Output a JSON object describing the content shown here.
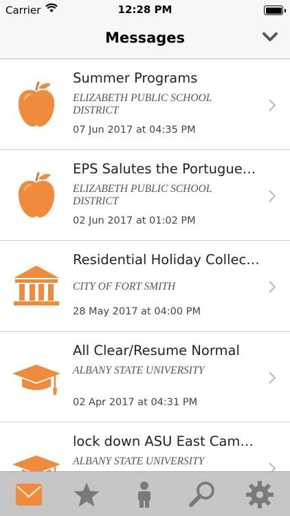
{
  "status_bar": {
    "carrier": "Carrier",
    "time": "12:28 PM"
  },
  "nav": {
    "title": "Messages"
  },
  "colors": {
    "accent": "#f08a3c",
    "accent_light": "#f7a55a",
    "tab_icon": "#7a7a7a",
    "tab_bar": "#c6c6c6"
  },
  "messages": [
    {
      "title": "Summer Programs",
      "sender": "ELIZABETH PUBLIC SCHOOL DISTRICT",
      "date": "07 Jun 2017 at 04:35 PM",
      "icon": "apple-icon"
    },
    {
      "title": "EPS Salutes the Portugue…",
      "sender": "ELIZABETH PUBLIC SCHOOL DISTRICT",
      "date": "02 Jun 2017 at 01:02 PM",
      "icon": "apple-icon"
    },
    {
      "title": "Residential Holiday Collec…",
      "sender": "CITY OF FORT SMITH",
      "date": "28 May 2017 at 04:00 PM",
      "icon": "government-building-icon"
    },
    {
      "title": "All Clear/Resume Normal",
      "sender": "ALBANY STATE UNIVERSITY",
      "date": "02 Apr 2017 at 04:31 PM",
      "icon": "graduation-cap-icon"
    },
    {
      "title": "lock down ASU East Cam…",
      "sender": "ALBANY STATE UNIVERSITY",
      "date": "",
      "icon": "graduation-cap-icon"
    }
  ],
  "tabs": [
    {
      "name": "messages",
      "icon": "envelope-icon",
      "active": true
    },
    {
      "name": "favorites",
      "icon": "star-icon",
      "active": false
    },
    {
      "name": "profile",
      "icon": "person-icon",
      "active": false
    },
    {
      "name": "search",
      "icon": "magnifier-icon",
      "active": false
    },
    {
      "name": "settings",
      "icon": "gear-icon",
      "active": false
    }
  ]
}
